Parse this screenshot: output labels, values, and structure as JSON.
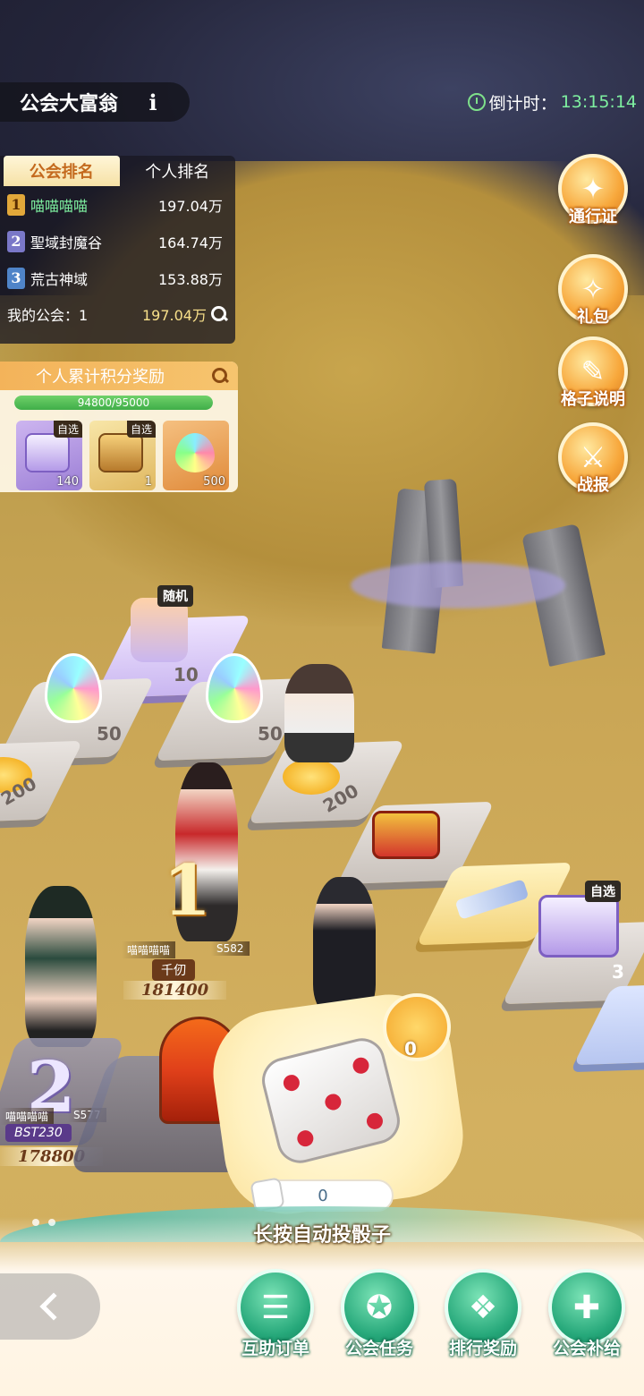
{
  "header": {
    "title": "公会大富翁",
    "info_glyph": "i",
    "countdown_label": "倒计时：",
    "countdown_value": "13:15:14"
  },
  "ranking": {
    "tabs": [
      {
        "label": "公会排名",
        "active": true
      },
      {
        "label": "个人排名",
        "active": false
      }
    ],
    "rows": [
      {
        "rank": "1",
        "name": "喵喵喵喵",
        "score": "197.04万"
      },
      {
        "rank": "2",
        "name": "聖域封魔谷",
        "score": "164.74万"
      },
      {
        "rank": "3",
        "name": "荒古神域",
        "score": "153.88万"
      }
    ],
    "my_guild_label": "我的公会：1",
    "my_guild_score": "197.04万"
  },
  "score_reward": {
    "title": "个人累计积分奖励",
    "progress_text": "94800/95000",
    "progress_fraction": 0.998,
    "items": [
      {
        "tag": "自选",
        "count": "140",
        "icon": "gift-box-icon"
      },
      {
        "tag": "自选",
        "count": "1",
        "icon": "treasure-chest-icon"
      },
      {
        "tag": "",
        "count": "500",
        "icon": "rainbow-gem-icon"
      }
    ]
  },
  "side_menu": [
    {
      "label": "通行证",
      "icon": "pass-icon",
      "glyph": "✦"
    },
    {
      "label": "礼包",
      "icon": "gift-bag-icon",
      "glyph": "✧"
    },
    {
      "label": "格子说明",
      "icon": "book-icon",
      "glyph": "✎"
    },
    {
      "label": "战报",
      "icon": "battle-report-icon",
      "glyph": "⚔"
    }
  ],
  "board": {
    "random_tag": "随机",
    "optional_tag": "自选",
    "tiles": {
      "random_box_value": "10",
      "gem_left_value": "50",
      "gem_mid_value": "50",
      "coin_left_value": "200",
      "coin_mid_value": "200",
      "box_right_value": "3"
    }
  },
  "leaders": {
    "first": {
      "rank": "1",
      "guild": "喵喵喵喵",
      "server": "S582",
      "name": "千仞",
      "power": "181400"
    },
    "second": {
      "rank": "2",
      "guild": "喵喵喵喵",
      "server": "S577",
      "name": "BST230",
      "power": "178800"
    }
  },
  "dice": {
    "small_count": "0",
    "roll_count": "0",
    "hold_hint": "长按自动投骰子"
  },
  "dock": [
    {
      "label": "互助订单",
      "icon": "scroll-icon",
      "glyph": "☰"
    },
    {
      "label": "公会任务",
      "icon": "medal-icon",
      "glyph": "✪"
    },
    {
      "label": "排行奖励",
      "icon": "gift-icon",
      "glyph": "❖"
    },
    {
      "label": "公会补给",
      "icon": "supply-bag-icon",
      "glyph": "✚"
    }
  ],
  "colors": {
    "accent_green": "#7ef0a0",
    "gold": "#f8e08a",
    "dock_green": "#26a87a",
    "side_orange": "#f7a73b"
  }
}
